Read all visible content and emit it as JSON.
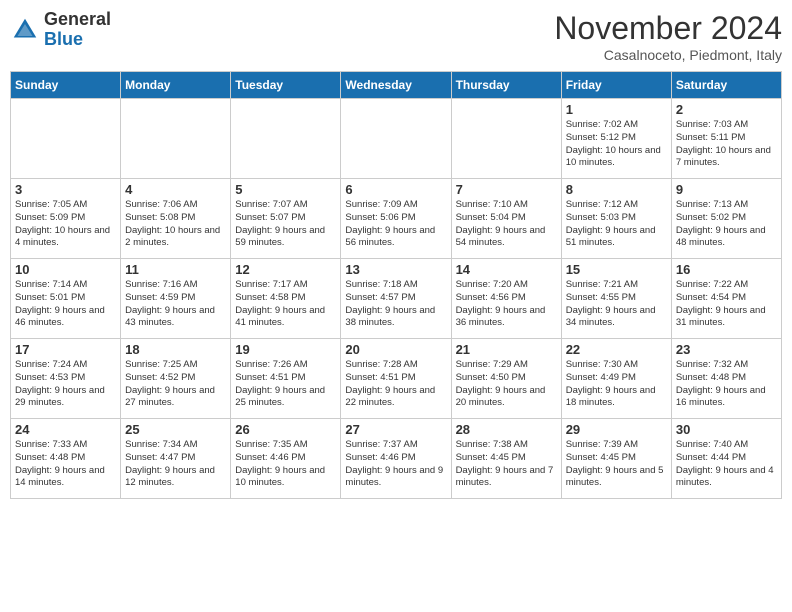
{
  "header": {
    "logo_general": "General",
    "logo_blue": "Blue",
    "month_title": "November 2024",
    "location": "Casalnoceto, Piedmont, Italy"
  },
  "weekdays": [
    "Sunday",
    "Monday",
    "Tuesday",
    "Wednesday",
    "Thursday",
    "Friday",
    "Saturday"
  ],
  "weeks": [
    [
      {
        "day": "",
        "info": ""
      },
      {
        "day": "",
        "info": ""
      },
      {
        "day": "",
        "info": ""
      },
      {
        "day": "",
        "info": ""
      },
      {
        "day": "",
        "info": ""
      },
      {
        "day": "1",
        "info": "Sunrise: 7:02 AM\nSunset: 5:12 PM\nDaylight: 10 hours\nand 10 minutes."
      },
      {
        "day": "2",
        "info": "Sunrise: 7:03 AM\nSunset: 5:11 PM\nDaylight: 10 hours\nand 7 minutes."
      }
    ],
    [
      {
        "day": "3",
        "info": "Sunrise: 7:05 AM\nSunset: 5:09 PM\nDaylight: 10 hours\nand 4 minutes."
      },
      {
        "day": "4",
        "info": "Sunrise: 7:06 AM\nSunset: 5:08 PM\nDaylight: 10 hours\nand 2 minutes."
      },
      {
        "day": "5",
        "info": "Sunrise: 7:07 AM\nSunset: 5:07 PM\nDaylight: 9 hours\nand 59 minutes."
      },
      {
        "day": "6",
        "info": "Sunrise: 7:09 AM\nSunset: 5:06 PM\nDaylight: 9 hours\nand 56 minutes."
      },
      {
        "day": "7",
        "info": "Sunrise: 7:10 AM\nSunset: 5:04 PM\nDaylight: 9 hours\nand 54 minutes."
      },
      {
        "day": "8",
        "info": "Sunrise: 7:12 AM\nSunset: 5:03 PM\nDaylight: 9 hours\nand 51 minutes."
      },
      {
        "day": "9",
        "info": "Sunrise: 7:13 AM\nSunset: 5:02 PM\nDaylight: 9 hours\nand 48 minutes."
      }
    ],
    [
      {
        "day": "10",
        "info": "Sunrise: 7:14 AM\nSunset: 5:01 PM\nDaylight: 9 hours\nand 46 minutes."
      },
      {
        "day": "11",
        "info": "Sunrise: 7:16 AM\nSunset: 4:59 PM\nDaylight: 9 hours\nand 43 minutes."
      },
      {
        "day": "12",
        "info": "Sunrise: 7:17 AM\nSunset: 4:58 PM\nDaylight: 9 hours\nand 41 minutes."
      },
      {
        "day": "13",
        "info": "Sunrise: 7:18 AM\nSunset: 4:57 PM\nDaylight: 9 hours\nand 38 minutes."
      },
      {
        "day": "14",
        "info": "Sunrise: 7:20 AM\nSunset: 4:56 PM\nDaylight: 9 hours\nand 36 minutes."
      },
      {
        "day": "15",
        "info": "Sunrise: 7:21 AM\nSunset: 4:55 PM\nDaylight: 9 hours\nand 34 minutes."
      },
      {
        "day": "16",
        "info": "Sunrise: 7:22 AM\nSunset: 4:54 PM\nDaylight: 9 hours\nand 31 minutes."
      }
    ],
    [
      {
        "day": "17",
        "info": "Sunrise: 7:24 AM\nSunset: 4:53 PM\nDaylight: 9 hours\nand 29 minutes."
      },
      {
        "day": "18",
        "info": "Sunrise: 7:25 AM\nSunset: 4:52 PM\nDaylight: 9 hours\nand 27 minutes."
      },
      {
        "day": "19",
        "info": "Sunrise: 7:26 AM\nSunset: 4:51 PM\nDaylight: 9 hours\nand 25 minutes."
      },
      {
        "day": "20",
        "info": "Sunrise: 7:28 AM\nSunset: 4:51 PM\nDaylight: 9 hours\nand 22 minutes."
      },
      {
        "day": "21",
        "info": "Sunrise: 7:29 AM\nSunset: 4:50 PM\nDaylight: 9 hours\nand 20 minutes."
      },
      {
        "day": "22",
        "info": "Sunrise: 7:30 AM\nSunset: 4:49 PM\nDaylight: 9 hours\nand 18 minutes."
      },
      {
        "day": "23",
        "info": "Sunrise: 7:32 AM\nSunset: 4:48 PM\nDaylight: 9 hours\nand 16 minutes."
      }
    ],
    [
      {
        "day": "24",
        "info": "Sunrise: 7:33 AM\nSunset: 4:48 PM\nDaylight: 9 hours\nand 14 minutes."
      },
      {
        "day": "25",
        "info": "Sunrise: 7:34 AM\nSunset: 4:47 PM\nDaylight: 9 hours\nand 12 minutes."
      },
      {
        "day": "26",
        "info": "Sunrise: 7:35 AM\nSunset: 4:46 PM\nDaylight: 9 hours\nand 10 minutes."
      },
      {
        "day": "27",
        "info": "Sunrise: 7:37 AM\nSunset: 4:46 PM\nDaylight: 9 hours\nand 9 minutes."
      },
      {
        "day": "28",
        "info": "Sunrise: 7:38 AM\nSunset: 4:45 PM\nDaylight: 9 hours\nand 7 minutes."
      },
      {
        "day": "29",
        "info": "Sunrise: 7:39 AM\nSunset: 4:45 PM\nDaylight: 9 hours\nand 5 minutes."
      },
      {
        "day": "30",
        "info": "Sunrise: 7:40 AM\nSunset: 4:44 PM\nDaylight: 9 hours\nand 4 minutes."
      }
    ]
  ]
}
